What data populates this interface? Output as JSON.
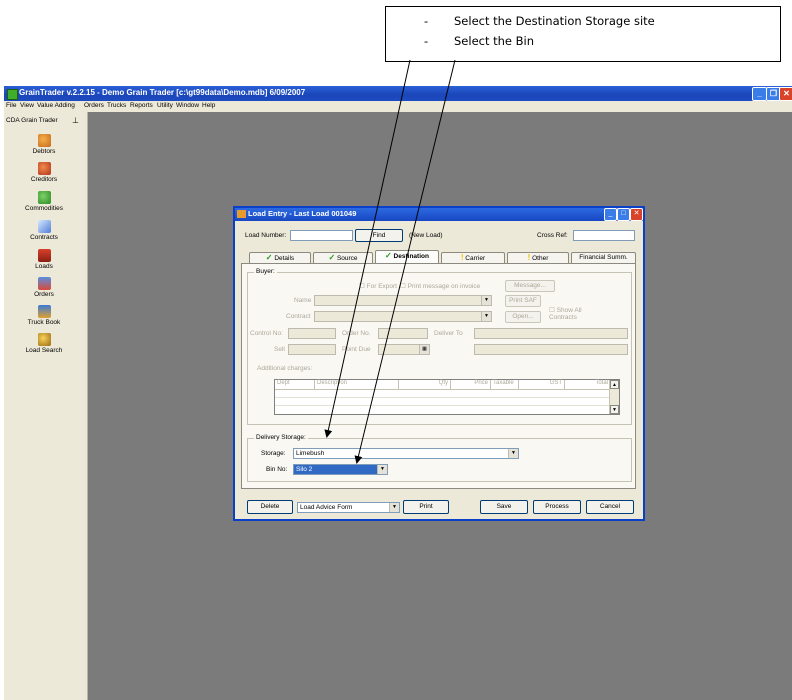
{
  "callout": {
    "lines": [
      {
        "dash": "-",
        "text": "Select the Destination Storage site"
      },
      {
        "dash": "-",
        "text": "Select the Bin"
      }
    ]
  },
  "app": {
    "title": "GrainTrader v.2.2.15 - Demo Grain Trader  [c:\\gt99data\\Demo.mdb] 6/09/2007",
    "menu": [
      "File",
      "View",
      "Value Adding",
      "Orders",
      "Trucks",
      "Reports",
      "Utility",
      "Window",
      "Help"
    ]
  },
  "sidebar": {
    "header": "CDA Grain Trader",
    "items": [
      {
        "label": "Debtors",
        "icon": "debtors-icon"
      },
      {
        "label": "Creditors",
        "icon": "creditors-icon"
      },
      {
        "label": "Commodities",
        "icon": "commodities-icon"
      },
      {
        "label": "Contracts",
        "icon": "contracts-icon"
      },
      {
        "label": "Loads",
        "icon": "loads-icon"
      },
      {
        "label": "Orders",
        "icon": "orders-icon"
      },
      {
        "label": "Truck Book",
        "icon": "truck-book-icon"
      },
      {
        "label": "Load Search",
        "icon": "load-search-icon"
      }
    ]
  },
  "dialog": {
    "title": "Load Entry - Last Load 001049",
    "load_number_label": "Load Number:",
    "load_number_value": "",
    "find_label": "Find",
    "status": "(New Load)",
    "cross_ref_label": "Cross Ref:",
    "cross_ref_value": "",
    "tabs": [
      "Details",
      "Source",
      "Destination",
      "Carrier",
      "Other",
      "Financial Summ."
    ],
    "buyer": {
      "title": "Buyer:",
      "for_export": "For Export",
      "print_message": "Print message on invoice",
      "message_btn": "Message...",
      "print_saf_btn": "Print SAF",
      "name_label": "Name",
      "contract_label": "Contract",
      "open_btn": "Open...",
      "show_all": "Show All Contracts",
      "control_no_label": "Control No:",
      "order_no_label": "Order No.",
      "deliver_to_label": "Deliver To",
      "sell_label": "Sell",
      "point_due_label": "Point Due",
      "additional_charges": "Additional charges:",
      "grid_headers": [
        "Dept",
        "Description",
        "Qty",
        "Price",
        "Taxable",
        "GST",
        "Total"
      ]
    },
    "delivery": {
      "title": "Delivery Storage:",
      "storage_label": "Storage:",
      "storage_value": "Limebush",
      "bin_label": "Bin No:",
      "bin_value": "Silo 2"
    },
    "footer": {
      "delete": "Delete",
      "report_value": "Load Advice Form",
      "print": "Print",
      "save": "Save",
      "process": "Process",
      "cancel": "Cancel"
    }
  }
}
